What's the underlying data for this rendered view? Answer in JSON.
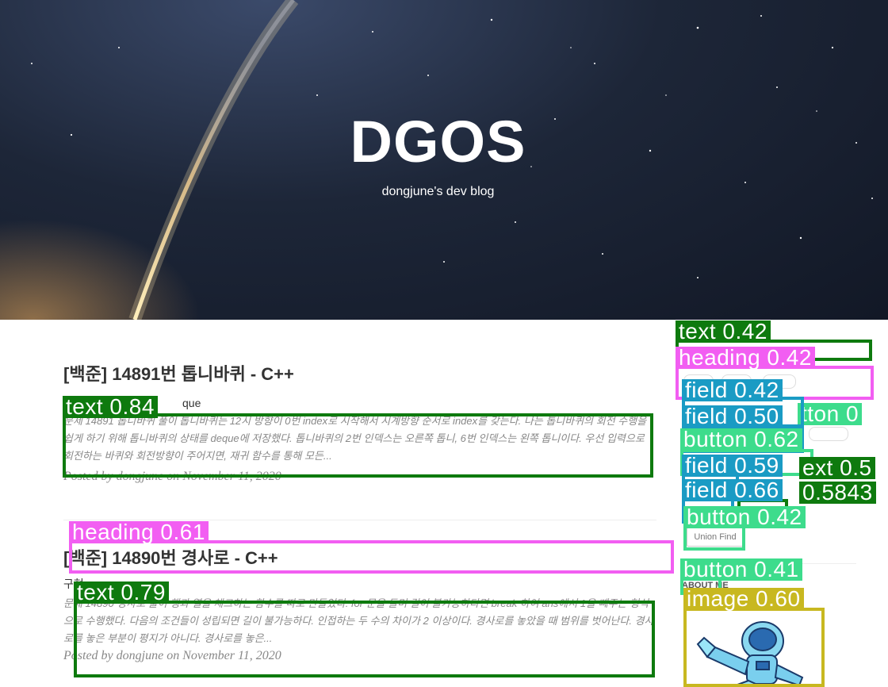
{
  "blog": {
    "title": "DGOS",
    "subtitle": "dongjune's dev blog"
  },
  "posts": [
    {
      "title": "[백준] 14891번 톱니바퀴 - C++",
      "subtitle": "que",
      "excerpt": "문제 14891 톱니바퀴 풀이 톱니바퀴는 12시 방향이 0번 index로 시작해서 시계방향 순서로 index를 갖는다. 나는 톱니바퀴의 회전 수행을 쉽게 하기 위해 톱니바퀴의 상태를 deque에 저장했다. 톱니바퀴의 2번 인덱스는 오른쪽 톱니, 6번 인덱스는 왼쪽 톱니이다. 우선 입력으로 회전하는 바퀴와 회전방향이 주어지면, 재귀 함수를 통해 모든...",
      "meta": "Posted by dongjune on November 11, 2020"
    },
    {
      "title": "[백준] 14890번 경사로 - C++",
      "subtitle": "구현",
      "excerpt": "문제 14890 경사로 풀이 행과 열을 체크하는 함수를 따로 만들었다: for 문을 돌며 길이 불가능하다면 break 하여 ans에서 1을 빼주는 형식으로 수행했다. 다음의 조건들이 성립되면 길이 불가능하다. 인접하는 두 수의 차이가 2 이상이다. 경사로를 놓았을 때 범위를 벗어난다. 경사로를 놓은 부분이 평지가 아니다. 경사로를 놓은...",
      "meta": "Posted by dongjune on November 11, 2020"
    }
  ],
  "sidebar": {
    "union_find": "Union Find",
    "about_label": "ABOUT ME"
  },
  "detections": {
    "text_1": "text 0.84",
    "heading_1": "heading 0.61",
    "text_2": "text 0.79",
    "side_text": "text 0.42",
    "side_heading": "heading 0.42",
    "field_1": "field 0.42",
    "field_2": "field 0.50",
    "button_1": "button 0.62",
    "field_3": "field 0.59",
    "field_4": "field 0.66",
    "button_2": "button 0.42",
    "button_3": "button 0.41",
    "image_1": "image 0.60",
    "cut_1": "tton 0",
    "cut_2": "ext 0.5",
    "cut_3": "0.5843"
  },
  "colors": {
    "text": "#0e7a0e",
    "heading": "#f25ef2",
    "field": "#1a9bc4",
    "button": "#3ddc8c",
    "image": "#c8b820"
  }
}
